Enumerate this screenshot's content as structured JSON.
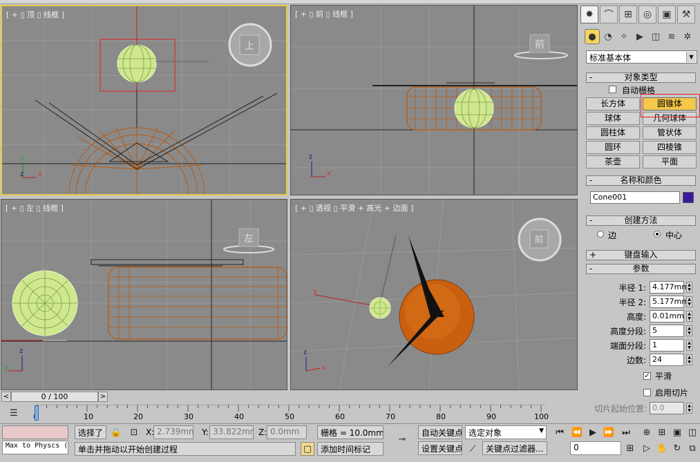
{
  "viewports": {
    "top": {
      "label": "[ + ▯ 顶 ▯ 线框 ]",
      "cube": "上"
    },
    "front": {
      "label": "[ + ▯ 前 ▯ 线框 ]",
      "cube": "前"
    },
    "left": {
      "label": "[ + ▯ 左 ▯ 线框 ]",
      "cube": "左"
    },
    "persp": {
      "label": "[ + ▯ 透视 ▯ 平滑 + 高光 + 边面 ]",
      "cube": "前"
    }
  },
  "axes": {
    "x": "x",
    "y": "y",
    "z": "z"
  },
  "command_panel": {
    "category_dropdown": "标准基本体",
    "rollouts": {
      "object_type": "对象类型",
      "name_color": "名称和颜色",
      "creation_method": "创建方法",
      "keyboard_entry": "键盘输入",
      "parameters": "参数"
    },
    "autogrid_label": "自动栅格",
    "object_buttons": [
      "长方体",
      "圆锥体",
      "球体",
      "几何球体",
      "圆柱体",
      "管状体",
      "圆环",
      "四棱锥",
      "茶壶",
      "平面"
    ],
    "object_name": "Cone001",
    "object_color": "#3a1a9a",
    "creation_methods": [
      "边",
      "中心"
    ],
    "params": {
      "radius1_label": "半径 1:",
      "radius1": "4.177mm",
      "radius2_label": "半径 2:",
      "radius2": "5.177mm",
      "height_label": "高度:",
      "height": "0.01mm",
      "height_seg_label": "高度分段:",
      "height_seg": "5",
      "cap_seg_label": "端面分段:",
      "cap_seg": "1",
      "sides_label": "边数:",
      "sides": "24",
      "smooth_label": "平滑",
      "slice_on_label": "启用切片",
      "slice_from_label": "切片起始位置:",
      "slice_from": "0.0"
    }
  },
  "timeline": {
    "frame": "0 / 100",
    "prev": "<",
    "next": ">",
    "ticks": [
      "0",
      "10",
      "20",
      "30",
      "40",
      "50",
      "60",
      "70",
      "80",
      "90",
      "100"
    ]
  },
  "status": {
    "script_listener": "Max to Physcs (",
    "selected": "选择了",
    "x_label": "X:",
    "x_value": "2.739mm",
    "y_label": "Y:",
    "y_value": "33.822mm",
    "z_label": "Z:",
    "z_value": "0.0mm",
    "grid": "栅格 = 10.0mm",
    "prompt": "单击并拖动以开始创建过程",
    "add_time_tag": "添加时间标记",
    "auto_key": "自动关键点",
    "set_key": "设置关键点",
    "selection_set": "选定对象",
    "key_filters": "关键点过滤器...",
    "current_frame": "0"
  },
  "colors": {
    "accent_active": "#e6c84a",
    "button_active": "#f5c84a",
    "wire_orange": "#b85a10",
    "wire_green": "#d8f0a0"
  }
}
